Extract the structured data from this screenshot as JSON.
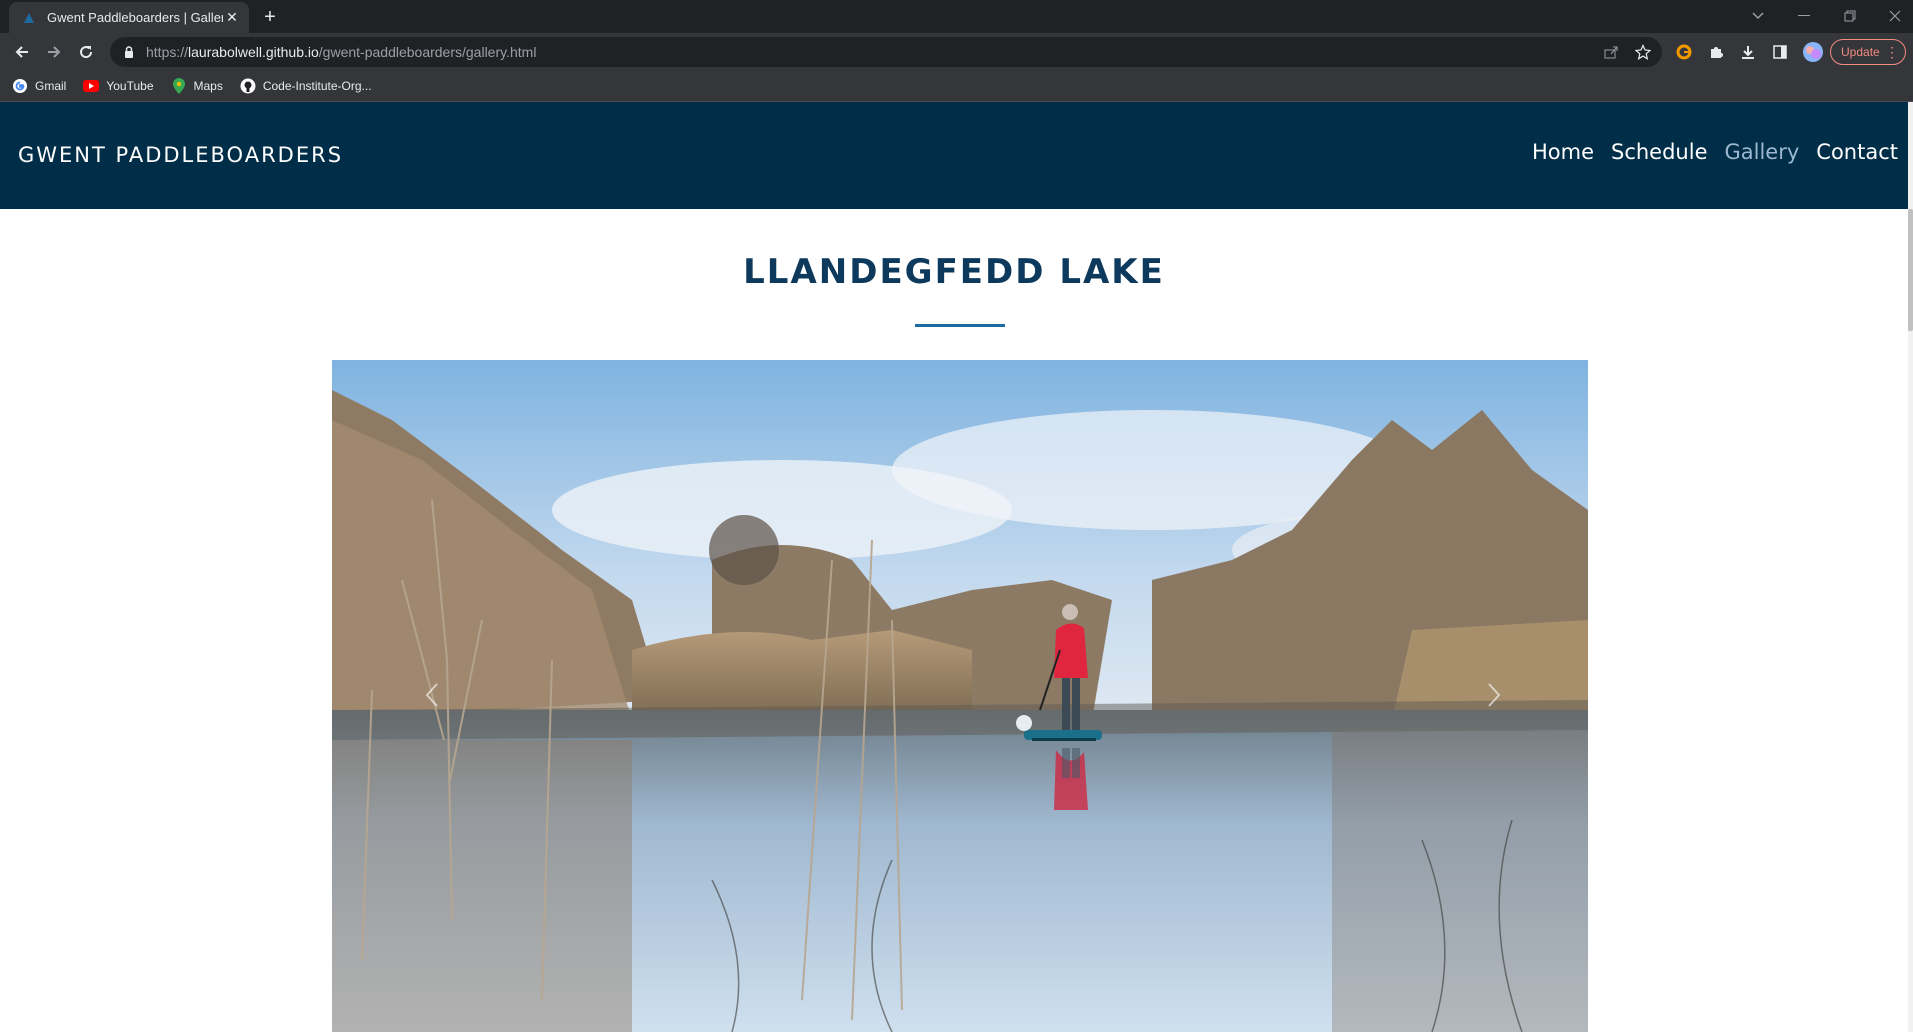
{
  "browser": {
    "tab_title": "Gwent Paddleboarders | Gallery",
    "url_scheme": "https://",
    "url_host": "laurabolwell.github.io",
    "url_path": "/gwent-paddleboarders/gallery.html",
    "update_label": "Update",
    "bookmarks": [
      {
        "label": "Gmail",
        "icon": "google-icon"
      },
      {
        "label": "YouTube",
        "icon": "youtube-icon"
      },
      {
        "label": "Maps",
        "icon": "maps-icon"
      },
      {
        "label": "Code-Institute-Org...",
        "icon": "github-icon"
      }
    ]
  },
  "site": {
    "brand": "GWENT PADDLEBOARDERS",
    "nav": [
      {
        "label": "Home",
        "active": false
      },
      {
        "label": "Schedule",
        "active": false
      },
      {
        "label": "Gallery",
        "active": true
      },
      {
        "label": "Contact",
        "active": false
      }
    ],
    "colors": {
      "nav_bg": "#002e48",
      "heading": "#0d3a5c",
      "accent": "#1d6aa1",
      "active_link": "#9bb8cf"
    }
  },
  "gallery": {
    "heading": "LLANDEGFEDD LAKE",
    "image_icon": "paddleboarder-photo"
  }
}
